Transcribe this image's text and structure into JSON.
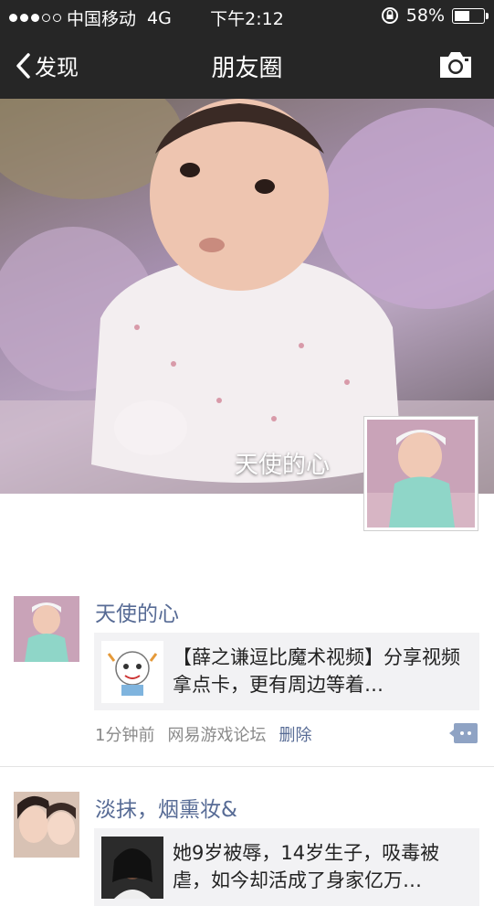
{
  "status_bar": {
    "carrier": "中国移动",
    "network": "4G",
    "time": "下午2:12",
    "battery": "58%",
    "battery_level": 0.58,
    "signal_bars": 3,
    "signal_total": 5
  },
  "nav": {
    "back_label": "发现",
    "title": "朋友圈",
    "camera_icon": "camera-icon"
  },
  "cover": {
    "display_name": "天使的心"
  },
  "posts": [
    {
      "name": "天使的心",
      "share_text": "【薛之谦逗比魔术视频】分享视频拿点卡，更有周边等着…",
      "time": "1分钟前",
      "source": "网易游戏论坛",
      "delete_label": "删除"
    },
    {
      "name": "淡抹，烟熏妆&",
      "share_text": "她9岁被辱，14岁生子，吸毒被虐，如今却活成了身家亿万…"
    }
  ],
  "colors": {
    "nav_bg": "#262626",
    "link": "#576b95",
    "share_bg": "#f2f2f4"
  }
}
